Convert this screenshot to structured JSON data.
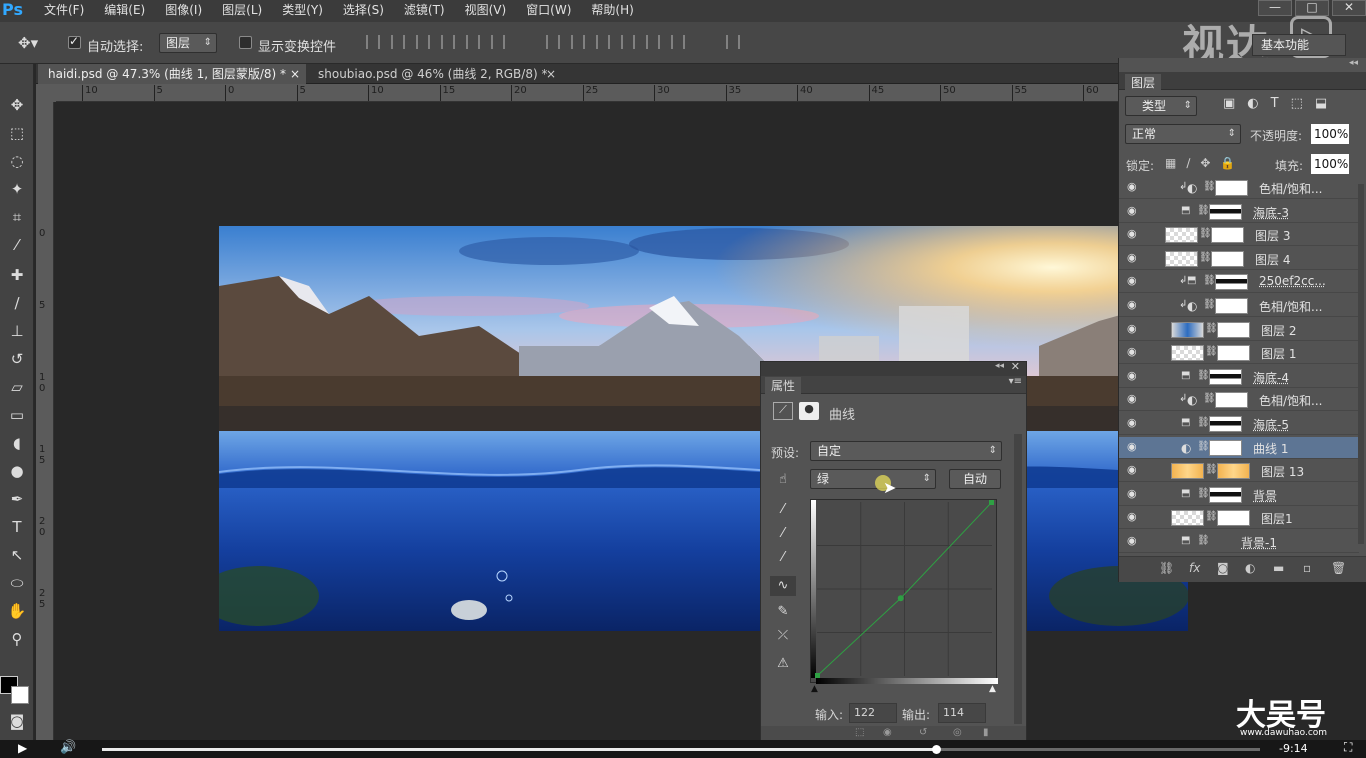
{
  "app": {
    "logo": "Ps"
  },
  "menu": [
    "文件(F)",
    "编辑(E)",
    "图像(I)",
    "图层(L)",
    "类型(Y)",
    "选择(S)",
    "滤镜(T)",
    "视图(V)",
    "窗口(W)",
    "帮助(H)"
  ],
  "window_buttons": [
    "—",
    "□",
    "✕"
  ],
  "options": {
    "auto_select_label": "自动选择:",
    "auto_select_value": "图层",
    "show_transform_label": "显示变换控件",
    "auto_select_checked": true,
    "show_transform_checked": false
  },
  "watermark": "视达",
  "workspace": "基本功能",
  "tabs": [
    {
      "label": "haidi.psd @ 47.3% (曲线 1, 图层蒙版/8) *",
      "active": true
    },
    {
      "label": "shoubiao.psd @ 46% (曲线 2, RGB/8) *",
      "active": false
    }
  ],
  "tab_close": "×",
  "ruler_h": [
    "10",
    "5",
    "0",
    "5",
    "10",
    "15",
    "20",
    "25",
    "30",
    "35",
    "40",
    "45",
    "50",
    "55",
    "60"
  ],
  "ruler_v": [
    "0",
    "5",
    "1\n0",
    "1\n5",
    "2\n0",
    "2\n5"
  ],
  "layers_panel": {
    "title": "图层",
    "filter_type": "类型",
    "blend_mode": "正常",
    "opacity_label": "不透明度:",
    "opacity": "100%",
    "lock_label": "锁定:",
    "fill_label": "填充:",
    "fill": "100%",
    "layers": [
      {
        "name": "色相/饱和...",
        "kind": "adjust",
        "thumb": "white",
        "clip": true
      },
      {
        "name": "海底-3",
        "kind": "mask",
        "thumb": "dark",
        "clip": false
      },
      {
        "name": "图层 3",
        "kind": "pixel",
        "thumb": "check",
        "clip": false
      },
      {
        "name": "图层 4",
        "kind": "pixel",
        "thumb": "check",
        "clip": false
      },
      {
        "name": "250ef2cc...",
        "kind": "mask",
        "thumb": "white",
        "clip": true
      },
      {
        "name": "色相/饱和...",
        "kind": "adjust",
        "thumb": "white",
        "clip": true
      },
      {
        "name": "图层 2",
        "kind": "pixel",
        "thumb": "blue",
        "clip": true
      },
      {
        "name": "图层 1",
        "kind": "pixel",
        "thumb": "check",
        "clip": true
      },
      {
        "name": "海底-4",
        "kind": "mask",
        "thumb": "dark",
        "clip": false
      },
      {
        "name": "色相/饱和...",
        "kind": "adjust",
        "thumb": "white",
        "clip": true
      },
      {
        "name": "海底-5",
        "kind": "mask",
        "thumb": "dark",
        "clip": false
      },
      {
        "name": "曲线 1",
        "kind": "adjust",
        "thumb": "white",
        "clip": false,
        "selected": true
      },
      {
        "name": "图层 13",
        "kind": "pixel",
        "thumb": "orange",
        "clip": true
      },
      {
        "name": "背景",
        "kind": "mask",
        "thumb": "dark",
        "clip": false
      },
      {
        "name": "图层1",
        "kind": "pixel",
        "thumb": "check",
        "clip": true
      },
      {
        "name": "背景-1",
        "kind": "mask",
        "thumb": "none",
        "clip": false
      }
    ],
    "footer_icons": [
      "link-icon",
      "fx-icon",
      "mask-icon",
      "adjustment-icon",
      "folder-icon",
      "new-layer-icon",
      "trash-icon"
    ]
  },
  "properties_panel": {
    "title": "属性",
    "header": "曲线",
    "preset_label": "预设:",
    "preset_value": "自定",
    "channel": "绿",
    "auto_button": "自动",
    "input_label": "输入:",
    "input_value": "122",
    "output_label": "输出:",
    "output_value": "114",
    "curve_point": {
      "input": 122,
      "output": 114
    },
    "curve_color": "#2ea043"
  },
  "video": {
    "time_remaining": "-9:14",
    "progress": 0.72
  },
  "brand": {
    "name": "大吴号",
    "url": "www.dawuhao.com"
  }
}
